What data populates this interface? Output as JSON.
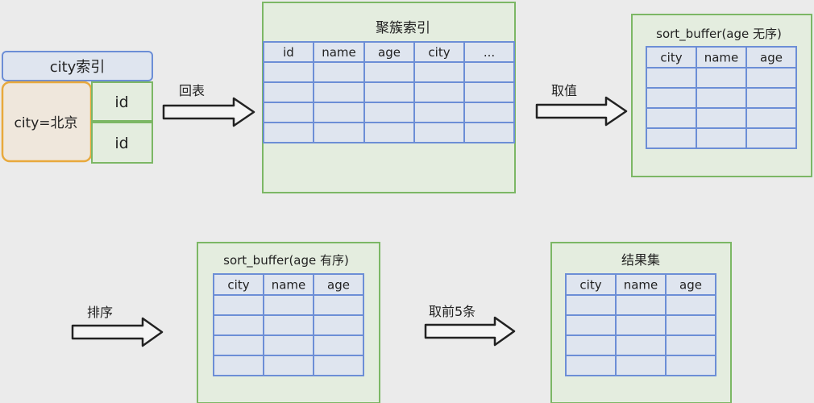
{
  "city_index": {
    "label": "city索引",
    "key": "city=北京",
    "ids": [
      "id",
      "id"
    ]
  },
  "arrows": {
    "back_to_table": "回表",
    "fetch": "取值",
    "sort": "排序",
    "take_first": "取前5条"
  },
  "clustered": {
    "title": "聚簇索引",
    "headers": [
      "id",
      "name",
      "age",
      "city",
      "..."
    ]
  },
  "sort_buffer_unordered": {
    "title": "sort_buffer(age 无序)",
    "headers": [
      "city",
      "name",
      "age"
    ]
  },
  "sort_buffer_ordered": {
    "title": "sort_buffer(age 有序)",
    "headers": [
      "city",
      "name",
      "age"
    ]
  },
  "result": {
    "title": "结果集",
    "headers": [
      "city",
      "name",
      "age"
    ]
  },
  "colors": {
    "green_stroke": "#7cb765",
    "green_fill": "#e4eddf",
    "blue_stroke": "#6c8ed6",
    "blue_fill": "#dfe5ef",
    "orange_stroke": "#e8a93c",
    "orange_fill": "#efe7dc"
  }
}
